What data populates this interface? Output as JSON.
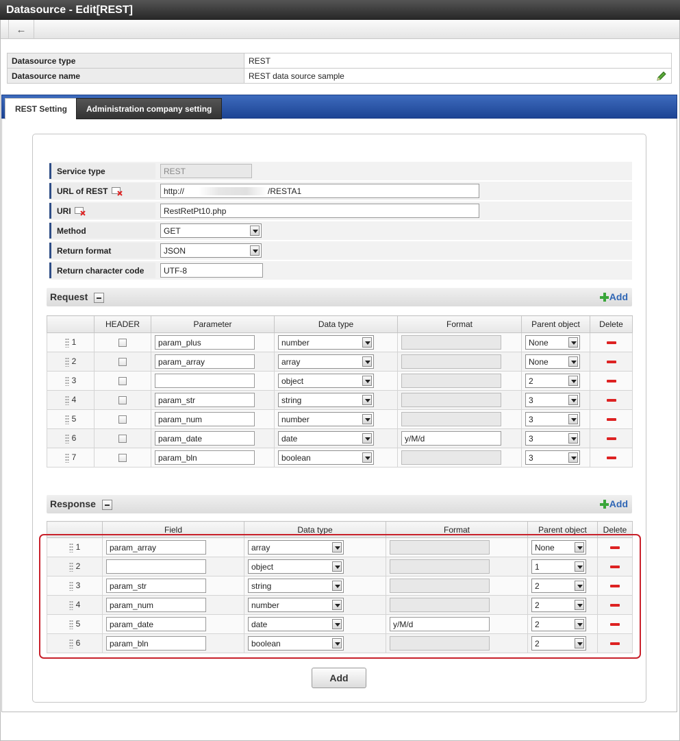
{
  "window": {
    "title": "Datasource - Edit[REST]"
  },
  "info": {
    "type_label": "Datasource type",
    "type_value": "REST",
    "name_label": "Datasource name",
    "name_value": "REST data source sample"
  },
  "tabs": [
    {
      "label": "REST Setting",
      "active": true
    },
    {
      "label": "Administration company setting",
      "active": false
    }
  ],
  "form": {
    "service_type": {
      "label": "Service type",
      "value": "REST"
    },
    "url": {
      "label": "URL of REST",
      "value_prefix": "http://",
      "value_suffix": "/RESTA1"
    },
    "uri": {
      "label": "URI",
      "value": "RestRetPt10.php"
    },
    "method": {
      "label": "Method",
      "value": "GET"
    },
    "return_format": {
      "label": "Return format",
      "value": "JSON"
    },
    "charset": {
      "label": "Return character code",
      "value": "UTF-8"
    }
  },
  "request": {
    "title": "Request",
    "add_label": "Add",
    "columns": [
      "HEADER",
      "Parameter",
      "Data type",
      "Format",
      "Parent object",
      "Delete"
    ],
    "rows": [
      {
        "num": "1",
        "param": "param_plus",
        "type": "number",
        "format": "",
        "parent": "None"
      },
      {
        "num": "2",
        "param": "param_array",
        "type": "array",
        "format": "",
        "parent": "None"
      },
      {
        "num": "3",
        "param": "",
        "type": "object",
        "format": "",
        "parent": "2"
      },
      {
        "num": "4",
        "param": "param_str",
        "type": "string",
        "format": "",
        "parent": "3"
      },
      {
        "num": "5",
        "param": "param_num",
        "type": "number",
        "format": "",
        "parent": "3"
      },
      {
        "num": "6",
        "param": "param_date",
        "type": "date",
        "format": "y/M/d",
        "parent": "3"
      },
      {
        "num": "7",
        "param": "param_bln",
        "type": "boolean",
        "format": "",
        "parent": "3"
      }
    ]
  },
  "response": {
    "title": "Response",
    "add_label": "Add",
    "columns": [
      "Field",
      "Data type",
      "Format",
      "Parent object",
      "Delete"
    ],
    "rows": [
      {
        "num": "1",
        "field": "param_array",
        "type": "array",
        "format": "",
        "parent": "None"
      },
      {
        "num": "2",
        "field": "",
        "type": "object",
        "format": "",
        "parent": "1"
      },
      {
        "num": "3",
        "field": "param_str",
        "type": "string",
        "format": "",
        "parent": "2"
      },
      {
        "num": "4",
        "field": "param_num",
        "type": "number",
        "format": "",
        "parent": "2"
      },
      {
        "num": "5",
        "field": "param_date",
        "type": "date",
        "format": "y/M/d",
        "parent": "2"
      },
      {
        "num": "6",
        "field": "param_bln",
        "type": "boolean",
        "format": "",
        "parent": "2"
      }
    ]
  },
  "footer": {
    "add_button": "Add"
  }
}
